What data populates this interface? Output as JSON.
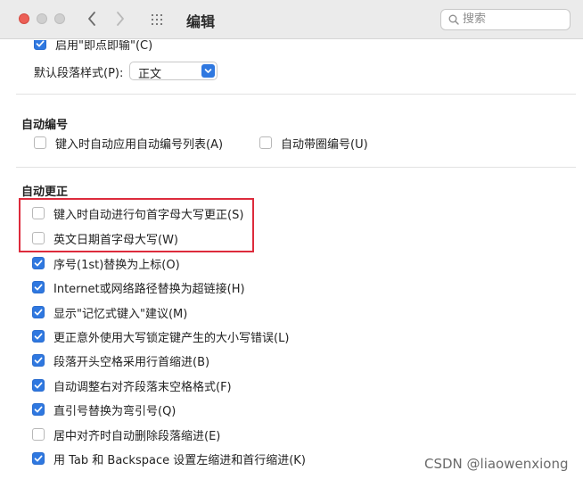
{
  "window": {
    "title": "编辑",
    "search_placeholder": "搜索"
  },
  "top_partial": {
    "checkbox_label": "启用\"即点即输\"(C)",
    "checked": true
  },
  "default_style": {
    "label": "默认段落样式(P):",
    "value": "正文"
  },
  "auto_numbering": {
    "title": "自动编号",
    "items": [
      {
        "label": "键入时自动应用自动编号列表(A)",
        "checked": false
      },
      {
        "label": "自动带圈编号(U)",
        "checked": false
      }
    ]
  },
  "auto_correct": {
    "title": "自动更正",
    "items": [
      {
        "label": "键入时自动进行句首字母大写更正(S)",
        "checked": false
      },
      {
        "label": "英文日期首字母大写(W)",
        "checked": false
      },
      {
        "label": "序号(1st)替换为上标(O)",
        "checked": true
      },
      {
        "label": "Internet或网络路径替换为超链接(H)",
        "checked": true
      },
      {
        "label": "显示\"记忆式键入\"建议(M)",
        "checked": true
      },
      {
        "label": "更正意外使用大写锁定键产生的大小写错误(L)",
        "checked": true
      },
      {
        "label": "段落开头空格采用行首缩进(B)",
        "checked": true
      },
      {
        "label": "自动调整右对齐段落末空格格式(F)",
        "checked": true
      },
      {
        "label": "直引号替换为弯引号(Q)",
        "checked": true
      },
      {
        "label": "居中对齐时自动删除段落缩进(E)",
        "checked": false
      },
      {
        "label": "用 Tab 和 Backspace 设置左缩进和首行缩进(K)",
        "checked": true
      }
    ]
  },
  "watermark": "CSDN @liaowenxiong",
  "colors": {
    "accent": "#2f78e0",
    "highlight_border": "#dd2b3c",
    "close_button": "#ec5f56"
  }
}
